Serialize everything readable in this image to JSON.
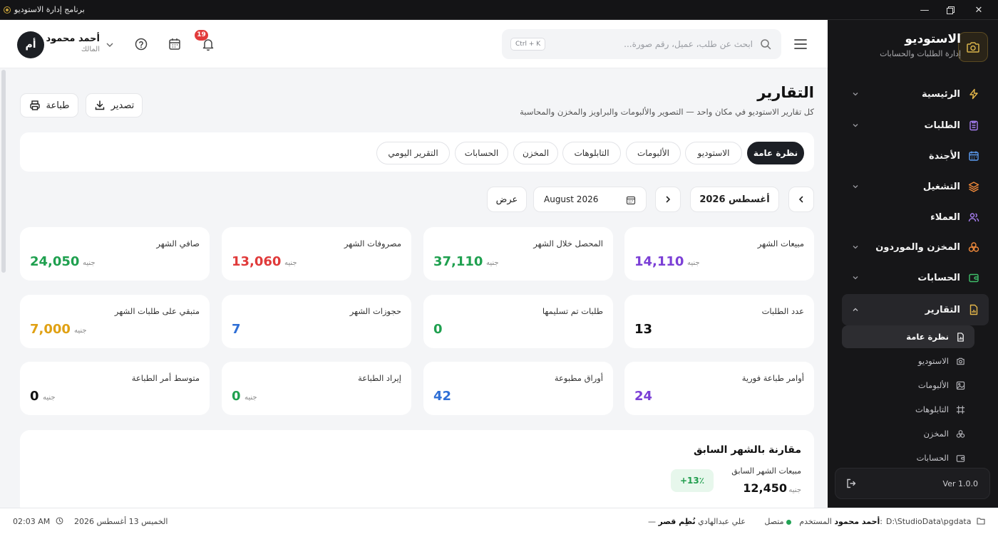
{
  "window": {
    "title": "برنامج إدارة الاستوديو"
  },
  "brand": {
    "title": "الاستوديو",
    "subtitle": "إدارة الطلبات والحسابات"
  },
  "sidebar": {
    "items": [
      {
        "label": "الرئيسية"
      },
      {
        "label": "الطلبات"
      },
      {
        "label": "الأجندة"
      },
      {
        "label": "التشغيل"
      },
      {
        "label": "العملاء"
      },
      {
        "label": "المخزن والموردون"
      },
      {
        "label": "الحسابات"
      },
      {
        "label": "التقارير"
      }
    ],
    "sub_items": [
      {
        "label": "نظرة عامة"
      },
      {
        "label": "الاستوديو"
      },
      {
        "label": "الألبومات"
      },
      {
        "label": "التابلوهات"
      },
      {
        "label": "المخزن"
      },
      {
        "label": "الحسابات"
      }
    ],
    "version": "Ver 1.0.0"
  },
  "header": {
    "search_placeholder": "ابحث عن طلب، عميل، رقم صورة...",
    "shortcut": "Ctrl + K",
    "notifications_count": "19",
    "user_name": "أحمد محمود",
    "user_role": "المالك",
    "avatar_initials": "أم"
  },
  "page": {
    "title": "التقارير",
    "subtitle": "كل تقارير الاستوديو في مكان واحد — التصوير والألبومات والبراويز والمخزن والمحاسبة",
    "export_label": "تصدير",
    "print_label": "طباعة"
  },
  "tabs": [
    {
      "label": "نظرة عامة",
      "active": true
    },
    {
      "label": "الاستوديو"
    },
    {
      "label": "الألبومات"
    },
    {
      "label": "التابلوهات"
    },
    {
      "label": "المخزن"
    },
    {
      "label": "الحسابات"
    },
    {
      "label": "التقرير اليومي"
    }
  ],
  "period": {
    "month_label": "أغسطس 2026",
    "date_value": "August 2026",
    "view_label": "عرض"
  },
  "stats": [
    {
      "label": "مبيعات الشهر",
      "value": "14,110",
      "unit": "جنيه",
      "color": "#7b3fd6"
    },
    {
      "label": "المحصل خلال الشهر",
      "value": "37,110",
      "unit": "جنيه",
      "color": "#1fa04f"
    },
    {
      "label": "مصروفات الشهر",
      "value": "13,060",
      "unit": "جنيه",
      "color": "#e03a3a"
    },
    {
      "label": "صافي الشهر",
      "value": "24,050",
      "unit": "جنيه",
      "color": "#1fa04f"
    },
    {
      "label": "عدد الطلبات",
      "value": "13",
      "unit": "",
      "color": "#111111"
    },
    {
      "label": "طلبات تم تسليمها",
      "value": "0",
      "unit": "",
      "color": "#1fa04f"
    },
    {
      "label": "حجوزات الشهر",
      "value": "7",
      "unit": "",
      "color": "#2f6fd6"
    },
    {
      "label": "متبقي على طلبات الشهر",
      "value": "7,000",
      "unit": "جنيه",
      "color": "#e0a114"
    },
    {
      "label": "أوامر طباعة فورية",
      "value": "24",
      "unit": "",
      "color": "#7b3fd6"
    },
    {
      "label": "أوراق مطبوعة",
      "value": "42",
      "unit": "",
      "color": "#2f6fd6"
    },
    {
      "label": "إيراد الطباعة",
      "value": "0",
      "unit": "جنيه",
      "color": "#1fa04f"
    },
    {
      "label": "متوسط أمر الطباعة",
      "value": "0",
      "unit": "جنيه",
      "color": "#111111"
    }
  ],
  "comparison": {
    "title": "مقارنة بالشهر السابق",
    "label": "مبيعات الشهر السابق",
    "value": "12,450",
    "unit": "جنيه",
    "change": "+13٪"
  },
  "statusbar": {
    "path": "D:\\StudioData\\pgdata",
    "user_prefix": "المستخدم:",
    "user_name": "أحمد محمود",
    "connection": "متصل",
    "quote": "نُظِم قصر",
    "quote_author": "— علي عبدالهادي",
    "date": "الخميس 13 أغسطس 2026",
    "time": "02:03 AM"
  },
  "colors": {
    "accent": "#c8a23a",
    "sidebar_bg": "#161618",
    "dark_button": "#1c1f25"
  }
}
